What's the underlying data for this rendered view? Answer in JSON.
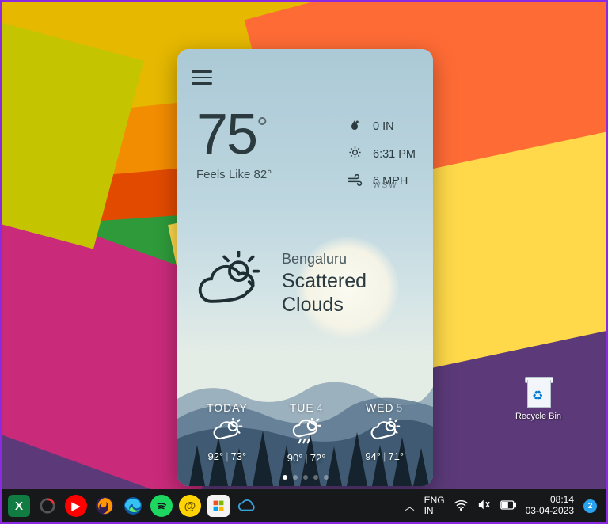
{
  "desktop": {
    "recycle_bin_label": "Recycle Bin"
  },
  "weather": {
    "current_temp": "75",
    "degree_symbol": "°",
    "feels_like": "Feels Like 82°",
    "precipitation": "0 IN",
    "sun_time": "6:31 PM",
    "wind_speed": "6 MPH",
    "wind_dir": "WSW",
    "location": "Bengaluru",
    "description": "Scattered Clouds",
    "forecast": [
      {
        "day": "TODAY",
        "daynum": "",
        "hi": "92°",
        "lo": "73°",
        "icon": "partly"
      },
      {
        "day": "TUE",
        "daynum": "4",
        "hi": "90°",
        "lo": "72°",
        "icon": "shower"
      },
      {
        "day": "WED",
        "daynum": "5",
        "hi": "94°",
        "lo": "71°",
        "icon": "partly"
      }
    ],
    "page_dots": {
      "count": 5,
      "active": 0
    }
  },
  "taskbar": {
    "lang1": "ENG",
    "lang2": "IN",
    "time": "08:14",
    "date": "03-04-2023",
    "notification_count": "2"
  }
}
